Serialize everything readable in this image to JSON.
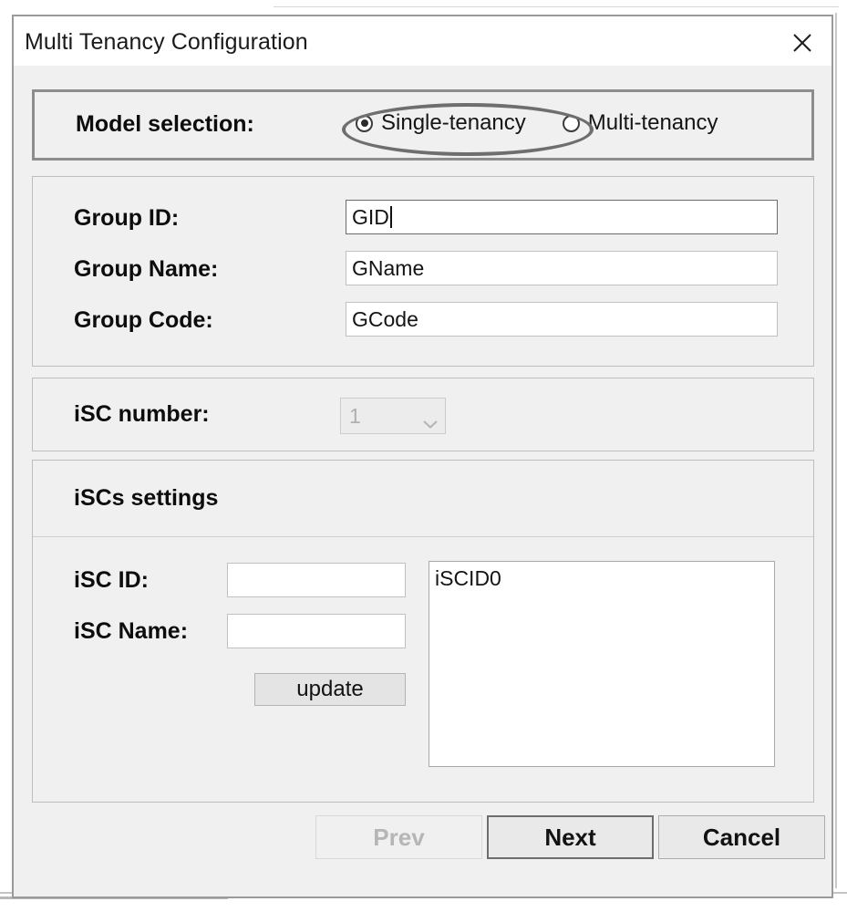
{
  "window": {
    "title": "Multi Tenancy Configuration",
    "close_icon": "close-icon"
  },
  "model_selection": {
    "label": "Model selection:",
    "options": [
      {
        "label": "Single-tenancy",
        "selected": true
      },
      {
        "label": "Multi-tenancy",
        "selected": false
      }
    ],
    "highlight_color": "#6e6e6e"
  },
  "group_panel": {
    "fields": [
      {
        "label": "Group ID:",
        "value": "GID",
        "placeholder": "",
        "focused": true
      },
      {
        "label": "Group Name:",
        "value": "GName",
        "placeholder": "",
        "focused": false
      },
      {
        "label": "Group Code:",
        "value": "GCode",
        "placeholder": "",
        "focused": false
      }
    ]
  },
  "isc_number_panel": {
    "label": "iSC number:",
    "value": "1",
    "disabled": true,
    "dropdown_icon": "chevron-down-icon"
  },
  "iscs_panel": {
    "header": "iSCs settings",
    "fields": [
      {
        "label": "iSC ID:",
        "value": "",
        "placeholder": ""
      },
      {
        "label": "iSC Name:",
        "value": "",
        "placeholder": ""
      }
    ],
    "update_label": "update",
    "list_items": [
      "iSCID0"
    ]
  },
  "footer": {
    "buttons": [
      {
        "label": "Prev",
        "state": "disabled"
      },
      {
        "label": "Next",
        "state": "default"
      },
      {
        "label": "Cancel",
        "state": "normal"
      }
    ]
  }
}
